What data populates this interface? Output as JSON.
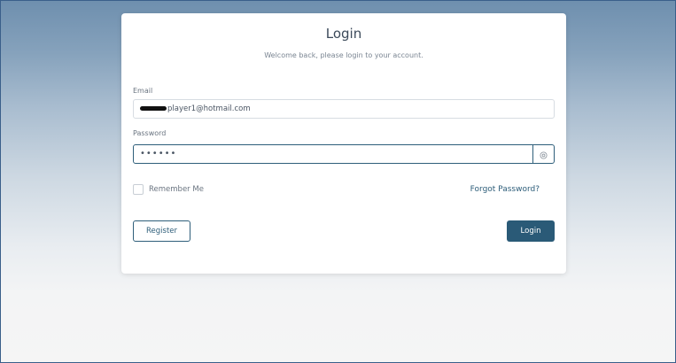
{
  "login_card": {
    "title": "Login",
    "subtitle": "Welcome back, please login to your account.",
    "email": {
      "label": "Email",
      "value_visible": "player1@hotmail.com"
    },
    "password": {
      "label": "Password",
      "masked_value": "••••••",
      "toggle_icon": "eye-icon"
    },
    "remember_me_label": "Remember Me",
    "remember_me_checked": false,
    "forgot_password_label": "Forgot Password?",
    "register_label": "Register",
    "login_label": "Login"
  },
  "colors": {
    "primary": "#2a5a77",
    "card_background": "#ffffff",
    "background_top": "#6e8fae",
    "background_bottom": "#f5f5f5"
  }
}
